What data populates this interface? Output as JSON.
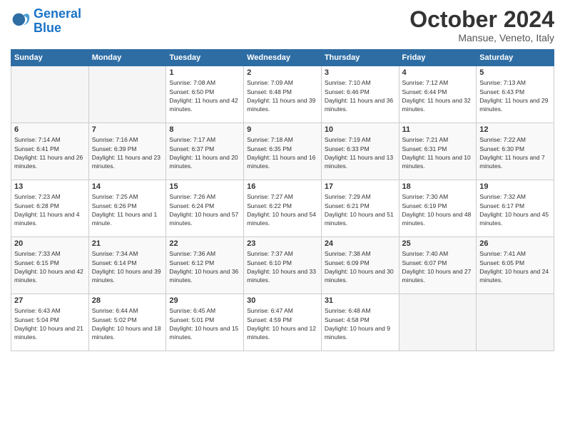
{
  "header": {
    "logo_line1": "General",
    "logo_line2": "Blue",
    "month": "October 2024",
    "location": "Mansue, Veneto, Italy"
  },
  "weekdays": [
    "Sunday",
    "Monday",
    "Tuesday",
    "Wednesday",
    "Thursday",
    "Friday",
    "Saturday"
  ],
  "weeks": [
    [
      {
        "day": "",
        "empty": true
      },
      {
        "day": "",
        "empty": true
      },
      {
        "day": "1",
        "sunrise": "Sunrise: 7:08 AM",
        "sunset": "Sunset: 6:50 PM",
        "daylight": "Daylight: 11 hours and 42 minutes."
      },
      {
        "day": "2",
        "sunrise": "Sunrise: 7:09 AM",
        "sunset": "Sunset: 6:48 PM",
        "daylight": "Daylight: 11 hours and 39 minutes."
      },
      {
        "day": "3",
        "sunrise": "Sunrise: 7:10 AM",
        "sunset": "Sunset: 6:46 PM",
        "daylight": "Daylight: 11 hours and 36 minutes."
      },
      {
        "day": "4",
        "sunrise": "Sunrise: 7:12 AM",
        "sunset": "Sunset: 6:44 PM",
        "daylight": "Daylight: 11 hours and 32 minutes."
      },
      {
        "day": "5",
        "sunrise": "Sunrise: 7:13 AM",
        "sunset": "Sunset: 6:43 PM",
        "daylight": "Daylight: 11 hours and 29 minutes."
      }
    ],
    [
      {
        "day": "6",
        "sunrise": "Sunrise: 7:14 AM",
        "sunset": "Sunset: 6:41 PM",
        "daylight": "Daylight: 11 hours and 26 minutes."
      },
      {
        "day": "7",
        "sunrise": "Sunrise: 7:16 AM",
        "sunset": "Sunset: 6:39 PM",
        "daylight": "Daylight: 11 hours and 23 minutes."
      },
      {
        "day": "8",
        "sunrise": "Sunrise: 7:17 AM",
        "sunset": "Sunset: 6:37 PM",
        "daylight": "Daylight: 11 hours and 20 minutes."
      },
      {
        "day": "9",
        "sunrise": "Sunrise: 7:18 AM",
        "sunset": "Sunset: 6:35 PM",
        "daylight": "Daylight: 11 hours and 16 minutes."
      },
      {
        "day": "10",
        "sunrise": "Sunrise: 7:19 AM",
        "sunset": "Sunset: 6:33 PM",
        "daylight": "Daylight: 11 hours and 13 minutes."
      },
      {
        "day": "11",
        "sunrise": "Sunrise: 7:21 AM",
        "sunset": "Sunset: 6:31 PM",
        "daylight": "Daylight: 11 hours and 10 minutes."
      },
      {
        "day": "12",
        "sunrise": "Sunrise: 7:22 AM",
        "sunset": "Sunset: 6:30 PM",
        "daylight": "Daylight: 11 hours and 7 minutes."
      }
    ],
    [
      {
        "day": "13",
        "sunrise": "Sunrise: 7:23 AM",
        "sunset": "Sunset: 6:28 PM",
        "daylight": "Daylight: 11 hours and 4 minutes."
      },
      {
        "day": "14",
        "sunrise": "Sunrise: 7:25 AM",
        "sunset": "Sunset: 6:26 PM",
        "daylight": "Daylight: 11 hours and 1 minute."
      },
      {
        "day": "15",
        "sunrise": "Sunrise: 7:26 AM",
        "sunset": "Sunset: 6:24 PM",
        "daylight": "Daylight: 10 hours and 57 minutes."
      },
      {
        "day": "16",
        "sunrise": "Sunrise: 7:27 AM",
        "sunset": "Sunset: 6:22 PM",
        "daylight": "Daylight: 10 hours and 54 minutes."
      },
      {
        "day": "17",
        "sunrise": "Sunrise: 7:29 AM",
        "sunset": "Sunset: 6:21 PM",
        "daylight": "Daylight: 10 hours and 51 minutes."
      },
      {
        "day": "18",
        "sunrise": "Sunrise: 7:30 AM",
        "sunset": "Sunset: 6:19 PM",
        "daylight": "Daylight: 10 hours and 48 minutes."
      },
      {
        "day": "19",
        "sunrise": "Sunrise: 7:32 AM",
        "sunset": "Sunset: 6:17 PM",
        "daylight": "Daylight: 10 hours and 45 minutes."
      }
    ],
    [
      {
        "day": "20",
        "sunrise": "Sunrise: 7:33 AM",
        "sunset": "Sunset: 6:15 PM",
        "daylight": "Daylight: 10 hours and 42 minutes."
      },
      {
        "day": "21",
        "sunrise": "Sunrise: 7:34 AM",
        "sunset": "Sunset: 6:14 PM",
        "daylight": "Daylight: 10 hours and 39 minutes."
      },
      {
        "day": "22",
        "sunrise": "Sunrise: 7:36 AM",
        "sunset": "Sunset: 6:12 PM",
        "daylight": "Daylight: 10 hours and 36 minutes."
      },
      {
        "day": "23",
        "sunrise": "Sunrise: 7:37 AM",
        "sunset": "Sunset: 6:10 PM",
        "daylight": "Daylight: 10 hours and 33 minutes."
      },
      {
        "day": "24",
        "sunrise": "Sunrise: 7:38 AM",
        "sunset": "Sunset: 6:09 PM",
        "daylight": "Daylight: 10 hours and 30 minutes."
      },
      {
        "day": "25",
        "sunrise": "Sunrise: 7:40 AM",
        "sunset": "Sunset: 6:07 PM",
        "daylight": "Daylight: 10 hours and 27 minutes."
      },
      {
        "day": "26",
        "sunrise": "Sunrise: 7:41 AM",
        "sunset": "Sunset: 6:05 PM",
        "daylight": "Daylight: 10 hours and 24 minutes."
      }
    ],
    [
      {
        "day": "27",
        "sunrise": "Sunrise: 6:43 AM",
        "sunset": "Sunset: 5:04 PM",
        "daylight": "Daylight: 10 hours and 21 minutes."
      },
      {
        "day": "28",
        "sunrise": "Sunrise: 6:44 AM",
        "sunset": "Sunset: 5:02 PM",
        "daylight": "Daylight: 10 hours and 18 minutes."
      },
      {
        "day": "29",
        "sunrise": "Sunrise: 6:45 AM",
        "sunset": "Sunset: 5:01 PM",
        "daylight": "Daylight: 10 hours and 15 minutes."
      },
      {
        "day": "30",
        "sunrise": "Sunrise: 6:47 AM",
        "sunset": "Sunset: 4:59 PM",
        "daylight": "Daylight: 10 hours and 12 minutes."
      },
      {
        "day": "31",
        "sunrise": "Sunrise: 6:48 AM",
        "sunset": "Sunset: 4:58 PM",
        "daylight": "Daylight: 10 hours and 9 minutes."
      },
      {
        "day": "",
        "empty": true
      },
      {
        "day": "",
        "empty": true
      }
    ]
  ]
}
